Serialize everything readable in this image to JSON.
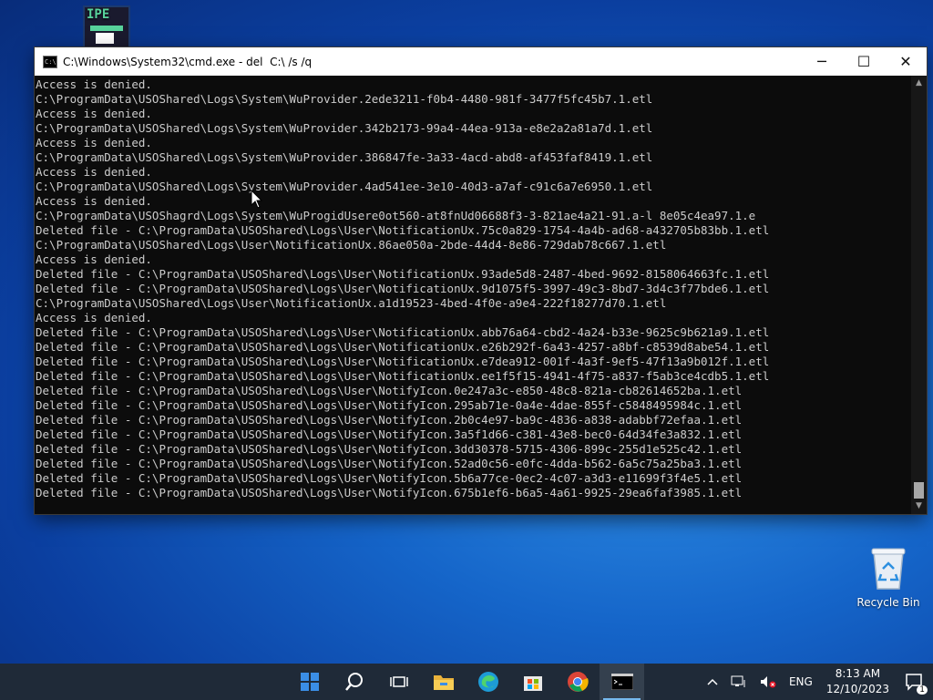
{
  "desktop": {
    "top_icon_label": "IPE",
    "recycle_bin_label": "Recycle Bin"
  },
  "window": {
    "title": "C:\\Windows\\System32\\cmd.exe - del  C:\\ /s /q",
    "minimize_glyph": "─",
    "maximize_glyph": "☐",
    "close_glyph": "✕",
    "icon_text": "C:\\",
    "lines": [
      "Access is denied.",
      "C:\\ProgramData\\USOShared\\Logs\\System\\WuProvider.2ede3211-f0b4-4480-981f-3477f5fc45b7.1.etl",
      "Access is denied.",
      "C:\\ProgramData\\USOShared\\Logs\\System\\WuProvider.342b2173-99a4-44ea-913a-e8e2a2a81a7d.1.etl",
      "Access is denied.",
      "C:\\ProgramData\\USOShared\\Logs\\System\\WuProvider.386847fe-3a33-4acd-abd8-af453faf8419.1.etl",
      "Access is denied.",
      "C:\\ProgramData\\USOShared\\Logs\\System\\WuProvider.4ad541ee-3e10-40d3-a7af-c91c6a7e6950.1.etl",
      "Access is denied.",
      "C:\\ProgramData\\USOShagrd\\Logs\\System\\WuProgidUsere0ot560-at8fnUd06688f3-3-821ae4a21-91.a-l 8e05c4ea97.1.e",
      "Deleted file - C:\\ProgramData\\USOShared\\Logs\\User\\NotificationUx.75c0a829-1754-4a4b-ad68-a432705b83bb.1.etl",
      "C:\\ProgramData\\USOShared\\Logs\\User\\NotificationUx.86ae050a-2bde-44d4-8e86-729dab78c667.1.etl",
      "Access is denied.",
      "Deleted file - C:\\ProgramData\\USOShared\\Logs\\User\\NotificationUx.93ade5d8-2487-4bed-9692-8158064663fc.1.etl",
      "Deleted file - C:\\ProgramData\\USOShared\\Logs\\User\\NotificationUx.9d1075f5-3997-49c3-8bd7-3d4c3f77bde6.1.etl",
      "C:\\ProgramData\\USOShared\\Logs\\User\\NotificationUx.a1d19523-4bed-4f0e-a9e4-222f18277d70.1.etl",
      "Access is denied.",
      "Deleted file - C:\\ProgramData\\USOShared\\Logs\\User\\NotificationUx.abb76a64-cbd2-4a24-b33e-9625c9b621a9.1.etl",
      "Deleted file - C:\\ProgramData\\USOShared\\Logs\\User\\NotificationUx.e26b292f-6a43-4257-a8bf-c8539d8abe54.1.etl",
      "Deleted file - C:\\ProgramData\\USOShared\\Logs\\User\\NotificationUx.e7dea912-001f-4a3f-9ef5-47f13a9b012f.1.etl",
      "Deleted file - C:\\ProgramData\\USOShared\\Logs\\User\\NotificationUx.ee1f5f15-4941-4f75-a837-f5ab3ce4cdb5.1.etl",
      "Deleted file - C:\\ProgramData\\USOShared\\Logs\\User\\NotifyIcon.0e247a3c-e850-48c8-821a-cb82614652ba.1.etl",
      "Deleted file - C:\\ProgramData\\USOShared\\Logs\\User\\NotifyIcon.295ab71e-0a4e-4dae-855f-c5848495984c.1.etl",
      "Deleted file - C:\\ProgramData\\USOShared\\Logs\\User\\NotifyIcon.2b0c4e97-ba9c-4836-a838-adabbf72efaa.1.etl",
      "Deleted file - C:\\ProgramData\\USOShared\\Logs\\User\\NotifyIcon.3a5f1d66-c381-43e8-bec0-64d34fe3a832.1.etl",
      "Deleted file - C:\\ProgramData\\USOShared\\Logs\\User\\NotifyIcon.3dd30378-5715-4306-899c-255d1e525c42.1.etl",
      "Deleted file - C:\\ProgramData\\USOShared\\Logs\\User\\NotifyIcon.52ad0c56-e0fc-4dda-b562-6a5c75a25ba3.1.etl",
      "Deleted file - C:\\ProgramData\\USOShared\\Logs\\User\\NotifyIcon.5b6a77ce-0ec2-4c07-a3d3-e11699f3f4e5.1.etl",
      "Deleted file - C:\\ProgramData\\USOShared\\Logs\\User\\NotifyIcon.675b1ef6-b6a5-4a61-9925-29ea6faf3985.1.etl"
    ]
  },
  "taskbar": {
    "items": [
      "start-icon",
      "search-icon",
      "task-view-icon",
      "file-explorer-icon",
      "edge-icon",
      "store-icon",
      "chrome-icon",
      "cmd-icon"
    ],
    "tray": {
      "language": "ENG",
      "time": "8:13 AM",
      "date": "12/10/2023",
      "notification_count": "1"
    }
  },
  "colors": {
    "console_bg": "#0c0c0c",
    "console_text": "#cccccc",
    "taskbar_bg": "#1f2a38",
    "accent": "#76b9ed"
  }
}
